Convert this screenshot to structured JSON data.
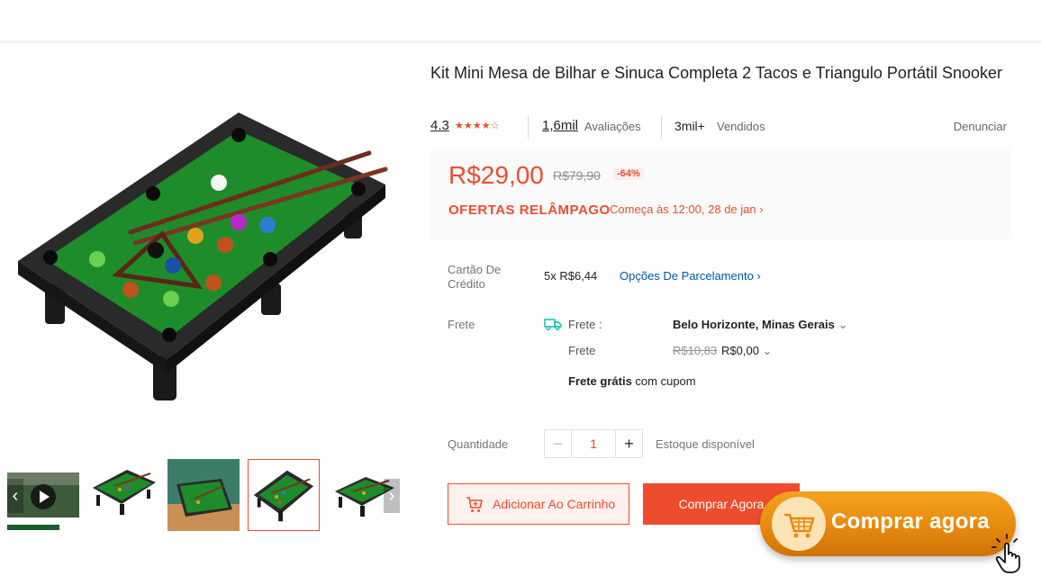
{
  "product": {
    "title": "Kit Mini Mesa de Bilhar e Sinuca Completa 2 Tacos e Triangulo Portátil Snooker",
    "rating": "4.3",
    "stars_icon": "star-rating-icon",
    "reviews_count": "1,6mil",
    "reviews_label": "Avaliações",
    "sold_count": "3mil+",
    "sold_label": "Vendidos",
    "report_label": "Denunciar"
  },
  "pricing": {
    "price": "R$29,00",
    "old_price": "R$79,90",
    "discount": "-64%",
    "flash_sale_label": "OFERTAS RELÂMPAGO",
    "flash_sale_info": "Começa às 12:00, 28 de jan",
    "accent_color": "#ee4d2d"
  },
  "payment": {
    "label": "Cartão De Crédito",
    "installments": "5x R$6,44",
    "installment_link": "Opções De Parcelamento"
  },
  "shipping": {
    "label": "Frete",
    "to_label": "Frete :",
    "destination": "Belo Horizonte, Minas Gerais",
    "cost_label": "Frete",
    "old_cost": "R$10,83",
    "new_cost": "R$0,00",
    "free_bold": "Frete grátis",
    "free_rest": " com cupom"
  },
  "quantity": {
    "label": "Quantidade",
    "minus": "−",
    "value": "1",
    "plus": "+",
    "stock": "Estoque disponível"
  },
  "actions": {
    "add_to_cart": "Adicionar Ao Carrinho",
    "buy_now": "Comprar Agora"
  },
  "overlay": {
    "cta_text": "Comprar agora",
    "cta_color": "#e8890d"
  },
  "gallery": {
    "prev_arrow": "‹",
    "next_arrow": "›"
  }
}
